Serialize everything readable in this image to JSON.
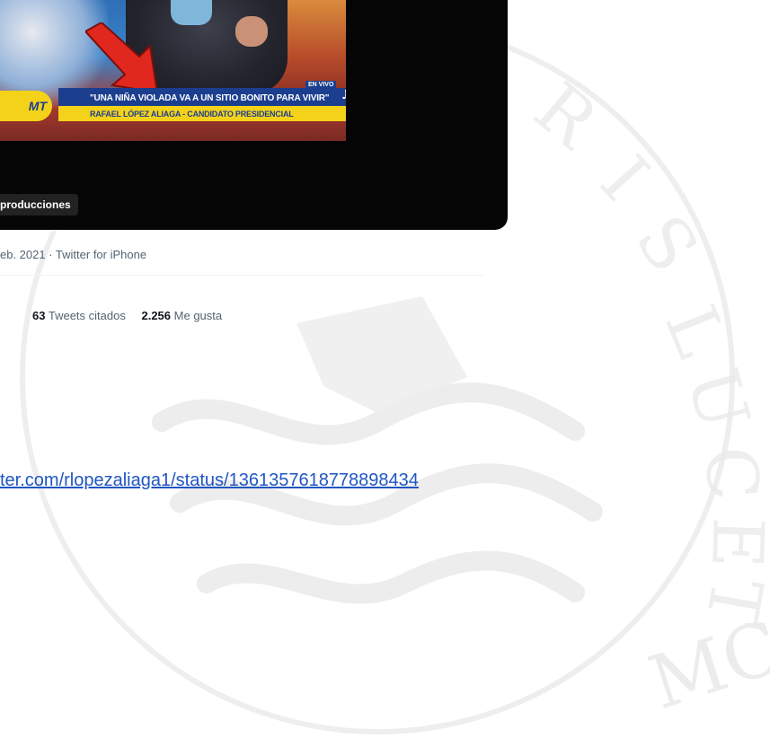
{
  "video": {
    "overlay_headline": "\"UNA NIÑA VIOLADA VA A UN SITIO BONITO PARA VIVIR\"",
    "overlay_subline": "RAFAEL LÓPEZ ALIAGA - CANDIDATO PRESIDENCIAL",
    "live_badge": "EN VIVO",
    "channel_logo": "MT",
    "username_tag": "producciones"
  },
  "tweet": {
    "timestamp_source": "eb. 2021 · Twitter for iPhone",
    "quote_tweets_count": "63",
    "quote_tweets_label": "Tweets citados",
    "likes_count": "2.256",
    "likes_label": "Me gusta"
  },
  "source_link": {
    "text": "ter.com/rlopezaliaga1/status/1361357618778898434"
  },
  "watermark": {
    "seal_text_top": "BRIS LUCET",
    "seal_text_bottom": "MCMXVII"
  },
  "colors": {
    "link": "#1f56c2",
    "muted_text": "#536471",
    "strong_text": "#0f1419",
    "video_bg": "#050505"
  }
}
